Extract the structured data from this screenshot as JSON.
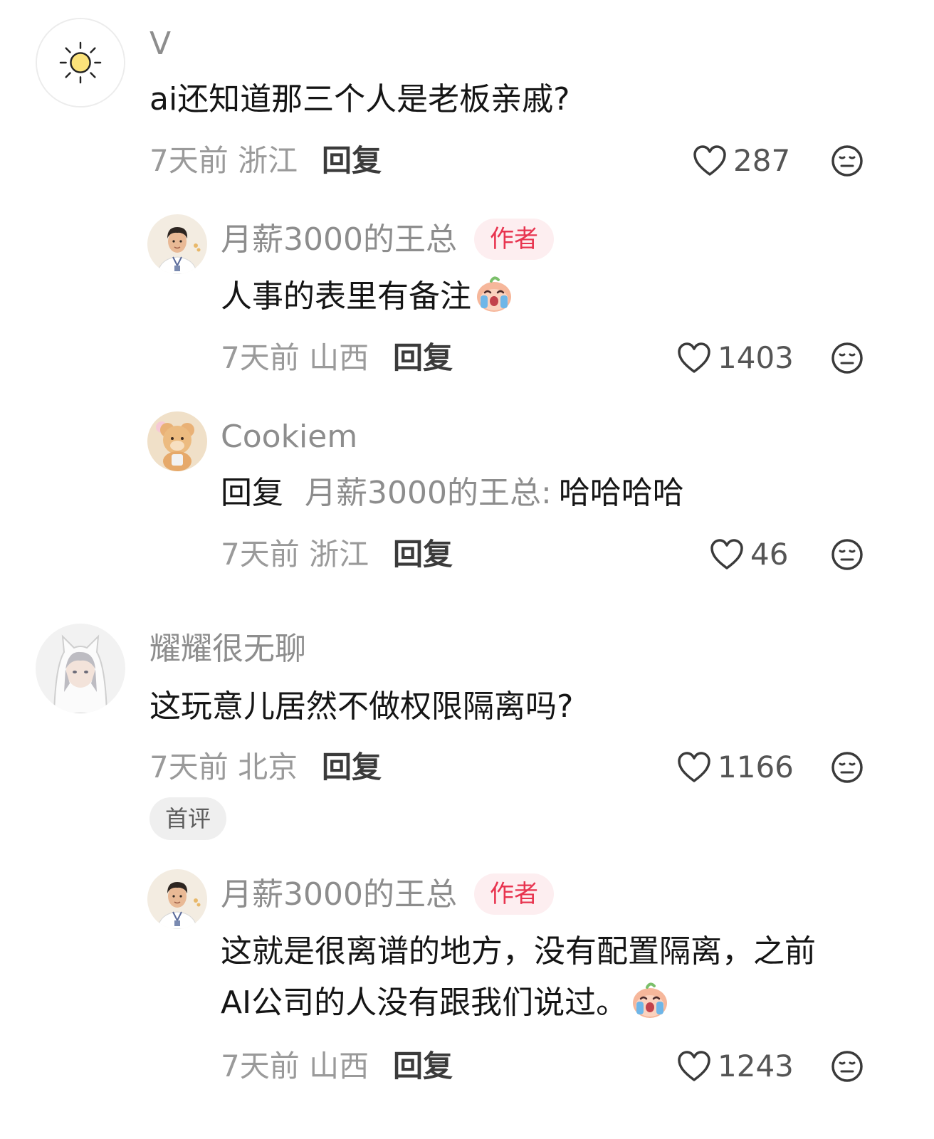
{
  "comments": [
    {
      "user": "V",
      "avatar": "sun-avatar",
      "text": "ai还知道那三个人是老板亲戚?",
      "time": "7天前 浙江",
      "reply_label": "回复",
      "likes": "287",
      "replies": [
        {
          "user": "月薪3000的王总",
          "badge": "作者",
          "avatar": "man-avatar",
          "text": "人事的表里有备注",
          "emoji": "crying-face-icon",
          "time": "7天前 山西",
          "reply_label": "回复",
          "likes": "1403"
        },
        {
          "user": "Cookiem",
          "avatar": "bear-avatar",
          "reply_prefix": "回复",
          "reply_target": "月薪3000的王总:",
          "text": "哈哈哈哈",
          "time": "7天前 浙江",
          "reply_label": "回复",
          "likes": "46"
        }
      ]
    },
    {
      "user": "耀耀很无聊",
      "avatar": "anime-avatar",
      "text": "这玩意儿居然不做权限隔离吗?",
      "time": "7天前 北京",
      "reply_label": "回复",
      "likes": "1166",
      "badge": "首评",
      "replies": [
        {
          "user": "月薪3000的王总",
          "badge": "作者",
          "avatar": "man-avatar",
          "text_line1": "这就是很离谱的地方，没有配置隔离，之前",
          "text_line2": "AI公司的人没有跟我们说过。",
          "emoji": "crying-face-icon",
          "time": "7天前 山西",
          "reply_label": "回复",
          "likes": "1243"
        }
      ]
    }
  ],
  "colors": {
    "author_badge_bg": "#fdeef0",
    "author_badge_text": "#e8344f",
    "first_badge_bg": "#efefef"
  }
}
